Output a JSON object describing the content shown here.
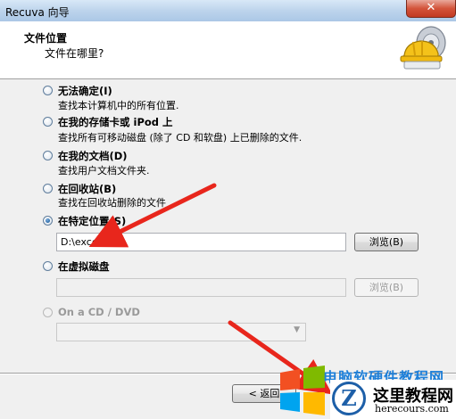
{
  "window": {
    "title": "Recuva 向导",
    "close_label": "✕"
  },
  "header": {
    "title": "文件位置",
    "subtitle": "文件在哪里?"
  },
  "options": [
    {
      "label": "无法确定(I)",
      "description": "查找本计算机中的所有位置.",
      "checked": false
    },
    {
      "label": "在我的存储卡或 iPod 上",
      "description": "查找所有可移动磁盘 (除了 CD 和软盘) 上已删除的文件.",
      "checked": false
    },
    {
      "label": "在我的文档(D)",
      "description": "查找用户文档文件夹.",
      "checked": false
    },
    {
      "label": "在回收站(B)",
      "description": "查找在回收站删除的文件",
      "checked": false
    },
    {
      "label": "在特定位置(S)",
      "checked": true
    },
    {
      "label": "在虚拟磁盘",
      "checked": false
    },
    {
      "label": "On a CD / DVD",
      "checked": false,
      "disabled": true
    }
  ],
  "specific_location": {
    "value": "D:\\excel",
    "browse_label": "浏览(B)"
  },
  "virtual_disk": {
    "browse_label": "浏览(B)"
  },
  "footer": {
    "back_label": "< 返回"
  },
  "watermark": {
    "overlay_text": "电脑软硬件教程网",
    "site_name": "这里教程网",
    "site_url": "herecours.com",
    "badge_letter": "Z"
  },
  "colors": {
    "arrow": "#e8261c",
    "titlebar": "#bdd4ec",
    "close": "#c23a22",
    "watermark_blue": "#1e7fd8"
  }
}
